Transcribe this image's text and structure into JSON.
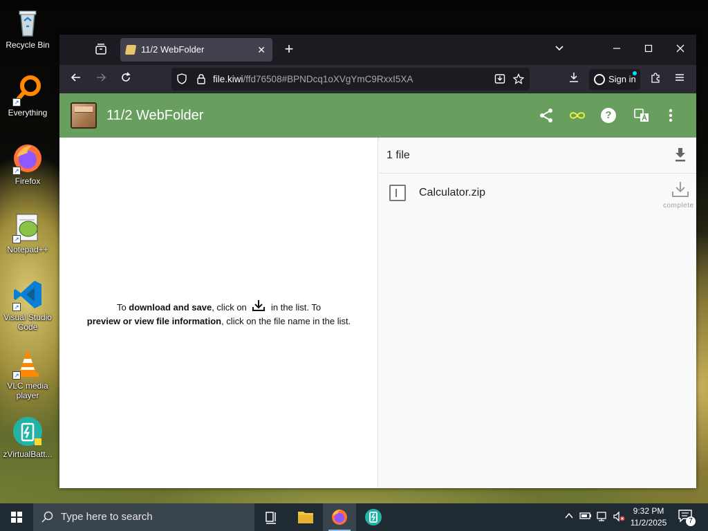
{
  "desktop": {
    "icons": [
      {
        "label": "Recycle Bin"
      },
      {
        "label": "Everything"
      },
      {
        "label": "Firefox"
      },
      {
        "label": "Notepad++"
      },
      {
        "label": "Visual Studio Code"
      },
      {
        "label": "VLC media player"
      },
      {
        "label": "zVirtualBatt..."
      }
    ]
  },
  "browser": {
    "tab": {
      "title": "11/2 WebFolder"
    },
    "url": {
      "domain": "file.kiwi",
      "path": "/ffd76508#BPNDcq1oXVgYmC9RxxI5XA"
    },
    "signin_label": "Sign in"
  },
  "app": {
    "title": "11/2 WebFolder",
    "header_color": "#689f5f",
    "hint": {
      "part1": "To ",
      "bold1": "download and save",
      "part2": ", click on",
      "part3": "in the list. To",
      "bold2": "preview or view file information",
      "part4": ", click on the file name in the list."
    },
    "files": {
      "count_label": "1 file",
      "items": [
        {
          "name": "Calculator.zip",
          "status": "complete"
        }
      ]
    }
  },
  "taskbar": {
    "search_placeholder": "Type here to search",
    "time": "9:32 PM",
    "date": "11/2/2025",
    "notifications": "7"
  }
}
